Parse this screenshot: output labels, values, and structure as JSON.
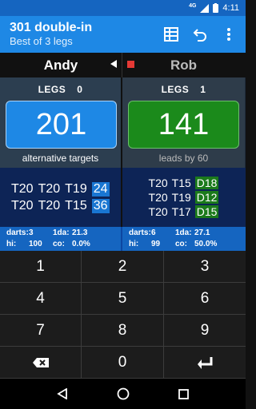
{
  "status": {
    "network": "4G",
    "time": "4:11"
  },
  "appbar": {
    "title": "301 double-in",
    "subtitle": "Best of 3 legs"
  },
  "players": {
    "left": "Andy",
    "right": "Rob"
  },
  "left": {
    "legs_label": "LEGS",
    "legs": "0",
    "score": "201",
    "hint": "alternative targets"
  },
  "right": {
    "legs_label": "LEGS",
    "legs": "1",
    "score": "141",
    "hint": "leads by 60"
  },
  "targets": {
    "left": [
      {
        "a": "T20",
        "b": "T20",
        "c": "T19",
        "rem": "24"
      },
      {
        "a": "T20",
        "b": "T20",
        "c": "T15",
        "rem": "36"
      }
    ],
    "right": [
      {
        "a": "T20",
        "b": "T15",
        "fin": "D18"
      },
      {
        "a": "T20",
        "b": "T19",
        "fin": "D12"
      },
      {
        "a": "T20",
        "b": "T17",
        "fin": "D15"
      }
    ]
  },
  "stats": {
    "left": {
      "darts_label": "darts:",
      "darts": "3",
      "avg_label": "1da:",
      "avg": "21.3",
      "hi_label": "hi:",
      "hi": "100",
      "co_label": "co:",
      "co": "0.0%"
    },
    "right": {
      "darts_label": "darts:",
      "darts": "6",
      "avg_label": "1da:",
      "avg": "27.1",
      "hi_label": "hi:",
      "hi": "99",
      "co_label": "co:",
      "co": "50.0%"
    }
  },
  "keypad": [
    "1",
    "2",
    "3",
    "4",
    "5",
    "6",
    "7",
    "8",
    "9",
    "",
    "0",
    ""
  ],
  "icons": [
    "scoresheet-icon",
    "undo-icon",
    "overflow-menu-icon",
    "backspace-icon",
    "enter-icon",
    "back-icon",
    "home-icon",
    "recents-icon"
  ]
}
